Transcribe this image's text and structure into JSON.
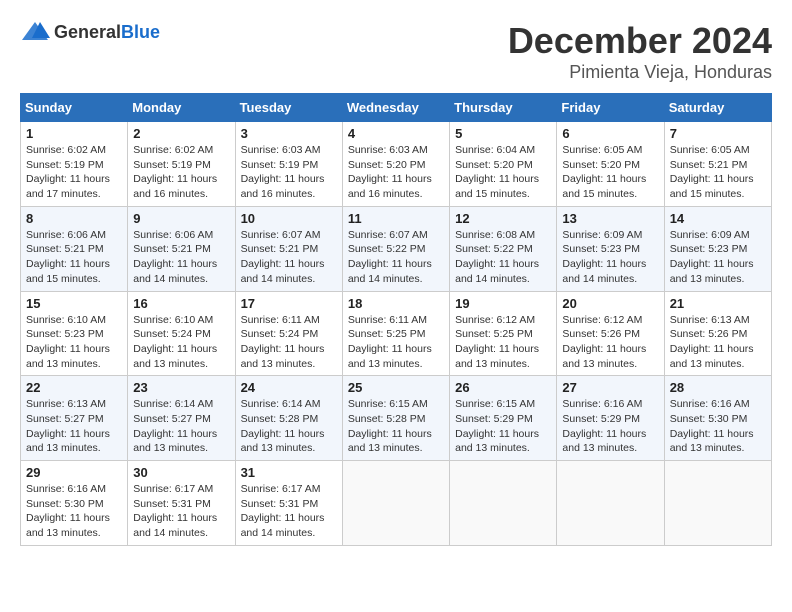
{
  "header": {
    "logo_general": "General",
    "logo_blue": "Blue",
    "month_title": "December 2024",
    "location": "Pimienta Vieja, Honduras"
  },
  "weekdays": [
    "Sunday",
    "Monday",
    "Tuesday",
    "Wednesday",
    "Thursday",
    "Friday",
    "Saturday"
  ],
  "weeks": [
    [
      {
        "day": "1",
        "sunrise": "6:02 AM",
        "sunset": "5:19 PM",
        "daylight": "11 hours and 17 minutes"
      },
      {
        "day": "2",
        "sunrise": "6:02 AM",
        "sunset": "5:19 PM",
        "daylight": "11 hours and 16 minutes"
      },
      {
        "day": "3",
        "sunrise": "6:03 AM",
        "sunset": "5:19 PM",
        "daylight": "11 hours and 16 minutes"
      },
      {
        "day": "4",
        "sunrise": "6:03 AM",
        "sunset": "5:20 PM",
        "daylight": "11 hours and 16 minutes"
      },
      {
        "day": "5",
        "sunrise": "6:04 AM",
        "sunset": "5:20 PM",
        "daylight": "11 hours and 15 minutes"
      },
      {
        "day": "6",
        "sunrise": "6:05 AM",
        "sunset": "5:20 PM",
        "daylight": "11 hours and 15 minutes"
      },
      {
        "day": "7",
        "sunrise": "6:05 AM",
        "sunset": "5:21 PM",
        "daylight": "11 hours and 15 minutes"
      }
    ],
    [
      {
        "day": "8",
        "sunrise": "6:06 AM",
        "sunset": "5:21 PM",
        "daylight": "11 hours and 15 minutes"
      },
      {
        "day": "9",
        "sunrise": "6:06 AM",
        "sunset": "5:21 PM",
        "daylight": "11 hours and 14 minutes"
      },
      {
        "day": "10",
        "sunrise": "6:07 AM",
        "sunset": "5:21 PM",
        "daylight": "11 hours and 14 minutes"
      },
      {
        "day": "11",
        "sunrise": "6:07 AM",
        "sunset": "5:22 PM",
        "daylight": "11 hours and 14 minutes"
      },
      {
        "day": "12",
        "sunrise": "6:08 AM",
        "sunset": "5:22 PM",
        "daylight": "11 hours and 14 minutes"
      },
      {
        "day": "13",
        "sunrise": "6:09 AM",
        "sunset": "5:23 PM",
        "daylight": "11 hours and 14 minutes"
      },
      {
        "day": "14",
        "sunrise": "6:09 AM",
        "sunset": "5:23 PM",
        "daylight": "11 hours and 13 minutes"
      }
    ],
    [
      {
        "day": "15",
        "sunrise": "6:10 AM",
        "sunset": "5:23 PM",
        "daylight": "11 hours and 13 minutes"
      },
      {
        "day": "16",
        "sunrise": "6:10 AM",
        "sunset": "5:24 PM",
        "daylight": "11 hours and 13 minutes"
      },
      {
        "day": "17",
        "sunrise": "6:11 AM",
        "sunset": "5:24 PM",
        "daylight": "11 hours and 13 minutes"
      },
      {
        "day": "18",
        "sunrise": "6:11 AM",
        "sunset": "5:25 PM",
        "daylight": "11 hours and 13 minutes"
      },
      {
        "day": "19",
        "sunrise": "6:12 AM",
        "sunset": "5:25 PM",
        "daylight": "11 hours and 13 minutes"
      },
      {
        "day": "20",
        "sunrise": "6:12 AM",
        "sunset": "5:26 PM",
        "daylight": "11 hours and 13 minutes"
      },
      {
        "day": "21",
        "sunrise": "6:13 AM",
        "sunset": "5:26 PM",
        "daylight": "11 hours and 13 minutes"
      }
    ],
    [
      {
        "day": "22",
        "sunrise": "6:13 AM",
        "sunset": "5:27 PM",
        "daylight": "11 hours and 13 minutes"
      },
      {
        "day": "23",
        "sunrise": "6:14 AM",
        "sunset": "5:27 PM",
        "daylight": "11 hours and 13 minutes"
      },
      {
        "day": "24",
        "sunrise": "6:14 AM",
        "sunset": "5:28 PM",
        "daylight": "11 hours and 13 minutes"
      },
      {
        "day": "25",
        "sunrise": "6:15 AM",
        "sunset": "5:28 PM",
        "daylight": "11 hours and 13 minutes"
      },
      {
        "day": "26",
        "sunrise": "6:15 AM",
        "sunset": "5:29 PM",
        "daylight": "11 hours and 13 minutes"
      },
      {
        "day": "27",
        "sunrise": "6:16 AM",
        "sunset": "5:29 PM",
        "daylight": "11 hours and 13 minutes"
      },
      {
        "day": "28",
        "sunrise": "6:16 AM",
        "sunset": "5:30 PM",
        "daylight": "11 hours and 13 minutes"
      }
    ],
    [
      {
        "day": "29",
        "sunrise": "6:16 AM",
        "sunset": "5:30 PM",
        "daylight": "11 hours and 13 minutes"
      },
      {
        "day": "30",
        "sunrise": "6:17 AM",
        "sunset": "5:31 PM",
        "daylight": "11 hours and 14 minutes"
      },
      {
        "day": "31",
        "sunrise": "6:17 AM",
        "sunset": "5:31 PM",
        "daylight": "11 hours and 14 minutes"
      },
      null,
      null,
      null,
      null
    ]
  ]
}
